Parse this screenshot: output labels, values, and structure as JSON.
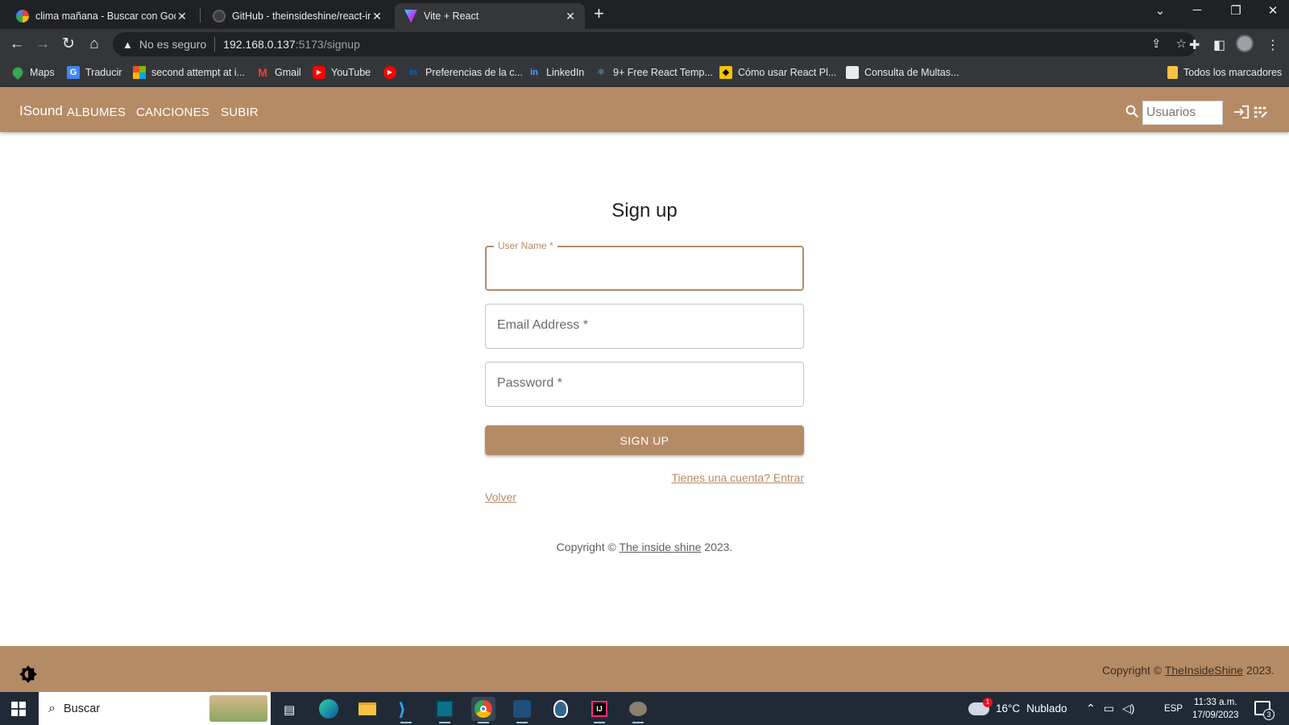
{
  "browser": {
    "tabs": [
      {
        "title": "clima mañana - Buscar con Goog",
        "icon": "google-icon",
        "active": false
      },
      {
        "title": "GitHub - theinsideshine/react-ins",
        "icon": "github-icon",
        "active": false
      },
      {
        "title": "Vite + React",
        "icon": "vite-icon",
        "active": true
      }
    ],
    "address": {
      "security_label": "No es seguro",
      "host": "192.168.0.137",
      "path": ":5173/signup"
    },
    "bookmarks": [
      {
        "label": "Maps",
        "icon": "maps-icon"
      },
      {
        "label": "Traducir",
        "icon": "translate-icon"
      },
      {
        "label": "second attempt at i...",
        "icon": "microsoft-icon"
      },
      {
        "label": "Gmail",
        "icon": "gmail-icon"
      },
      {
        "label": "YouTube",
        "icon": "youtube-icon"
      },
      {
        "label": "",
        "icon": "youtube-music-icon"
      },
      {
        "label": "Preferencias de la c...",
        "icon": "linkedin-icon"
      },
      {
        "label": "LinkedIn",
        "icon": "linkedin-icon"
      },
      {
        "label": "9+ Free React Temp...",
        "icon": "react-icon"
      },
      {
        "label": "Cómo usar React Pl...",
        "icon": "batman-icon"
      },
      {
        "label": "Consulta de Multas...",
        "icon": "document-icon"
      }
    ],
    "all_bookmarks_label": "Todos los marcadores"
  },
  "app": {
    "brand": "ISound",
    "nav": [
      "ALBUMES",
      "CANCIONES",
      "SUBIR"
    ],
    "user_search_placeholder": "Usuarios",
    "accent_color": "#b58b66"
  },
  "form": {
    "title": "Sign up",
    "username_label": "User Name *",
    "username_value": "",
    "email_label": "Email Address *",
    "email_value": "",
    "password_label": "Password *",
    "password_value": "",
    "submit_label": "SIGN UP",
    "signin_link": "Tienes una cuenta? Entrar",
    "back_link": "Volver"
  },
  "copyright_main": {
    "prefix": "Copyright © ",
    "link": "The inside shine",
    "suffix": " 2023."
  },
  "footer": {
    "prefix": "Copyright © ",
    "link": "TheInsideShine",
    "suffix": " 2023."
  },
  "taskbar": {
    "search_label": "Buscar",
    "weather_temp": "16°C",
    "weather_text": "Nublado",
    "weather_alerts": "1",
    "language": "ESP",
    "time": "11:33 a.m.",
    "date": "17/09/2023",
    "notifications": "3"
  }
}
